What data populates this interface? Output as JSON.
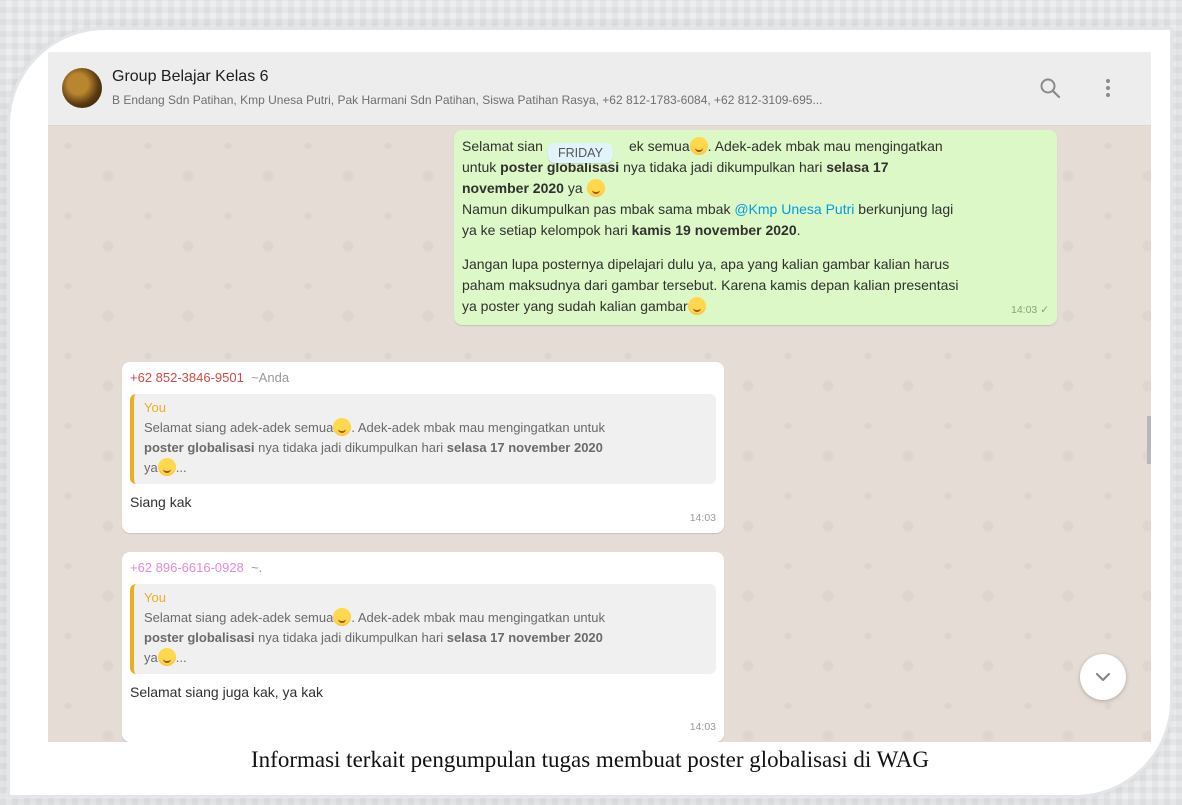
{
  "chat_header": {
    "group_name": "Group Belajar Kelas 6",
    "members": "B Endang Sdn Patihan, Kmp Unesa Putri, Pak Harmani Sdn Patihan, Siswa Patihan Rasya, +62 812-1783-6084, +62 812-3109-695..."
  },
  "date_chip": "FRIDAY",
  "outgoing": {
    "line1_a": "Selamat sian",
    "line1_b": "ek semua",
    "line1_c": ". Adek-adek mbak  mau mengingatkan",
    "line2_a": "untuk ",
    "line2_b": "poster globalisasi",
    "line2_c": " nya tidaka jadi dikumpulkan hari ",
    "line2_d": "selasa 17",
    "line3_a": "november 2020",
    "line3_b": " ya",
    "line4_a": "Namun dikumpulkan pas mbak sama mbak ",
    "line4_mention": "@Kmp Unesa Putri",
    "line4_b": " berkunjung lagi",
    "line5_a": "ya ke setiap kelompok hari ",
    "line5_b": "kamis 19 november 2020",
    "line5_c": ".",
    "line6": "Jangan lupa posternya dipelajari dulu ya, apa yang kalian gambar kalian harus",
    "line7": "paham maksudnya dari gambar tersebut. Karena kamis depan kalian presentasi",
    "line8": "ya poster yang sudah kalian gambar",
    "time": "14:03",
    "tick": "✓"
  },
  "incoming": [
    {
      "sender": "+62 852-3846-9501",
      "alias": "~Anda",
      "quote_author": "You",
      "quote_l1_a": "Selamat siang adek-adek semua",
      "quote_l1_b": ". Adek-adek mbak  mau mengingatkan untuk",
      "quote_l2_a": "poster globalisasi",
      "quote_l2_b": " nya tidaka jadi dikumpulkan hari ",
      "quote_l2_c": "selasa 17 november 2020",
      "quote_l3_a": "ya",
      "quote_l3_b": "...",
      "text": "Siang kak",
      "time": "14:03"
    },
    {
      "sender": "+62 896-6616-0928",
      "alias": "~.",
      "quote_author": "You",
      "quote_l1_a": "Selamat siang adek-adek semua",
      "quote_l1_b": ". Adek-adek mbak  mau mengingatkan untuk",
      "quote_l2_a": "poster globalisasi",
      "quote_l2_b": " nya tidaka jadi dikumpulkan hari ",
      "quote_l2_c": "selasa 17 november 2020",
      "quote_l3_a": "ya",
      "quote_l3_b": "...",
      "text": "Selamat siang juga kak, ya kak",
      "time": "14:03"
    }
  ],
  "caption": "Informasi terkait pengumpulan tugas membuat poster globalisasi di WAG",
  "icons": {
    "search": "search-icon",
    "menu": "menu-icon",
    "scroll_down": "chevron-down-icon",
    "emoji": "smile-emoji"
  },
  "colors": {
    "outgoing_bubble": "#dcf8c6",
    "incoming_bubble": "#ffffff",
    "chat_background": "#e5ddd5",
    "sender_1": "#d34949",
    "sender_2": "#e58ad0",
    "mention": "#039be5",
    "quote_accent": "#e8b020"
  }
}
